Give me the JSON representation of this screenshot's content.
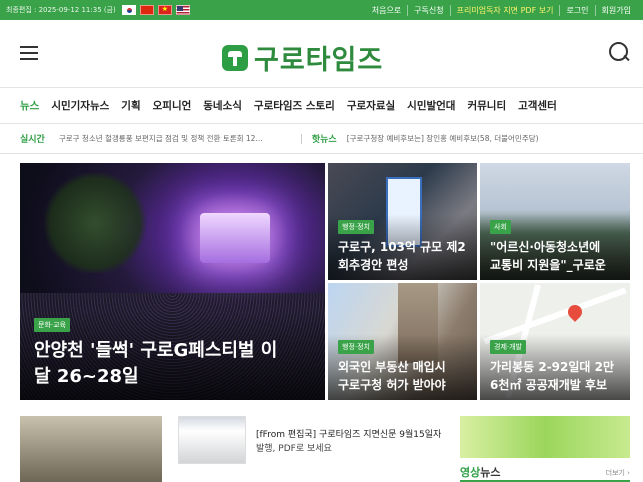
{
  "topbar": {
    "date": "최종편집 : 2025-09-12 11:35 (금)",
    "flags": [
      "kr",
      "cn",
      "vn",
      "us"
    ],
    "links": [
      "처음으로",
      "구독신청",
      "프리미엄독자 지면 PDF 보기",
      "로그인",
      "회원가입"
    ]
  },
  "header": {
    "logo_text": "구로타임즈"
  },
  "nav": {
    "items": [
      "뉴스",
      "시민기자뉴스",
      "기획",
      "오피니언",
      "동네소식",
      "구로타임즈 스토리",
      "구로자료실",
      "시민발언대",
      "커뮤니티",
      "고객센터"
    ]
  },
  "ticker": {
    "live_label": "실시간",
    "live_text": "구로구 청소년 헐갱룡풍 보편지급 점검 및 정책 전환 토론회 12...",
    "hot_label": "핫뉴스",
    "hot_text": "[구로구청장 예비후보는] 장인홍 예비후보(58, 더불어민주당)"
  },
  "feature": {
    "category": "문화·교육",
    "title_line1": "안양천 '들썩' 구로G페스티벌 이",
    "title_line2": "달 26~28일"
  },
  "cards": [
    {
      "category": "행정·정치",
      "line1": "구로구, 103억 규모 제2",
      "line2": "회추경안 편성"
    },
    {
      "category": "사회",
      "line1": "\"어르신·아동청소년에",
      "line2": "교통비 지원을\"_구로운"
    },
    {
      "category": "행정·정치",
      "line1": "외국인 부동산 매입시",
      "line2": "구로구청 허가 받아야"
    },
    {
      "category": "경제·개발",
      "line1": "가리봉동 2-92일대 2만",
      "line2": "6천㎡ 공공재개발 후보"
    }
  ],
  "bottom": {
    "news_line1": "[fFrom 편집국] 구로타임즈 지면신문 9월15일자",
    "news_line2": "발행, PDF로 보세요",
    "video_title_a": "영상",
    "video_title_b": "뉴스",
    "video_more": "더보기 ›"
  },
  "colors": {
    "brand": "#3aa34a",
    "accent": "#2e9e44"
  }
}
